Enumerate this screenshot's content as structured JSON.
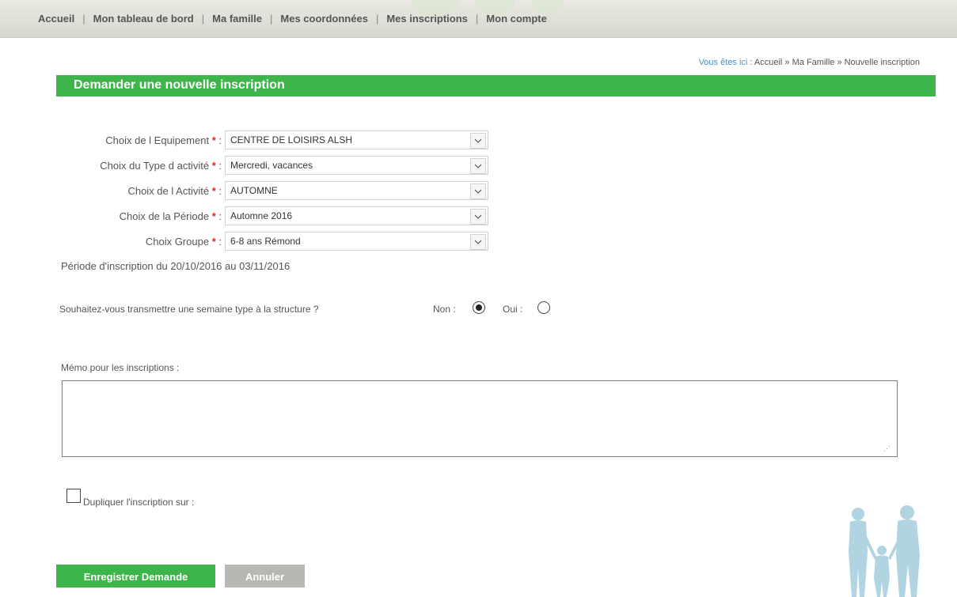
{
  "nav": {
    "items": [
      "Accueil",
      "Mon tableau de bord",
      "Ma famille",
      "Mes coordonnées",
      "Mes inscriptions",
      "Mon compte"
    ]
  },
  "breadcrumb": {
    "lead": "Vous êtes ici",
    "path": ": Accueil » Ma Famille » Nouvelle inscription"
  },
  "title": "Demander une nouvelle inscription",
  "fields": [
    {
      "label": "Choix de l Equipement",
      "value": "CENTRE DE LOISIRS ALSH"
    },
    {
      "label": "Choix du Type d activité",
      "value": "Mercredi, vacances"
    },
    {
      "label": "Choix de l Activité",
      "value": "AUTOMNE"
    },
    {
      "label": "Choix de la Période",
      "value": "Automne 2016"
    },
    {
      "label": "Choix Groupe",
      "value": "6-8 ans Rémond"
    }
  ],
  "required_mark": "*",
  "label_suffix": ":",
  "period_info": "Période d'inscription du 20/10/2016 au 03/11/2016",
  "question": {
    "text": "Souhaitez-vous transmettre une semaine type à la structure ?",
    "no_label": "Non :",
    "yes_label": "Oui :",
    "selected": "Non"
  },
  "memo": {
    "label": "Mémo pour les inscriptions :",
    "value": ""
  },
  "duplicate": {
    "label": "Dupliquer l'inscription sur :",
    "checked": false
  },
  "buttons": {
    "save": "Enregistrer Demande",
    "cancel": "Annuler"
  },
  "colors": {
    "accent_green": "#3db54a",
    "required_red": "#e0262b",
    "breadcrumb_blue": "#4a90c2",
    "cancel_gray": "#b7b8b2"
  }
}
